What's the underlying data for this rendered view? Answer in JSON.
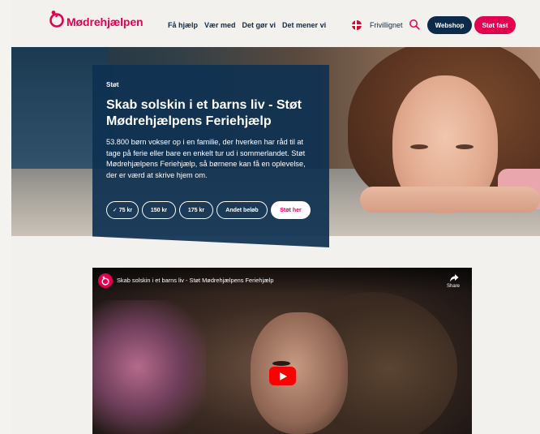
{
  "brand": {
    "name": "Mødrehjælpen",
    "color": "#e3004f",
    "navy": "#0c2a4a"
  },
  "nav": {
    "items": [
      {
        "label": "Få hjælp"
      },
      {
        "label": "Vær med"
      },
      {
        "label": "Det gør vi"
      },
      {
        "label": "Det mener vi"
      }
    ]
  },
  "header": {
    "language_icon": "danish-flag-icon",
    "volunteer_link": "Frivillignet",
    "search_icon": "search-icon",
    "webshop_label": "Webshop",
    "support_fixed_label": "Støt fast"
  },
  "hero": {
    "eyebrow": "Støt",
    "title": "Skab solskin i et barns liv - Støt Mødrehjælpens Feriehjælp",
    "body": "53.800 børn vokser op i en familie, der hverken har råd til at tage på ferie eller bare en enkelt tur ud i sommerlandet. Støt Mødrehjælpens Feriehjælp, så børnene kan få en oplevelse, der er værd at skrive hjem om.",
    "amounts": [
      {
        "label": "75 kr",
        "selected": true
      },
      {
        "label": "150 kr",
        "selected": false
      },
      {
        "label": "175 kr",
        "selected": false
      },
      {
        "label": "Andet beløb",
        "selected": false
      }
    ],
    "cta_label": "Støt her",
    "card_color": "#0f3252"
  },
  "video": {
    "title": "Skab solskin i et barns liv - Støt Mødrehjælpens Feriehjælp",
    "share_label": "Share",
    "play_icon": "play-icon",
    "play_color": "#ff0000"
  }
}
